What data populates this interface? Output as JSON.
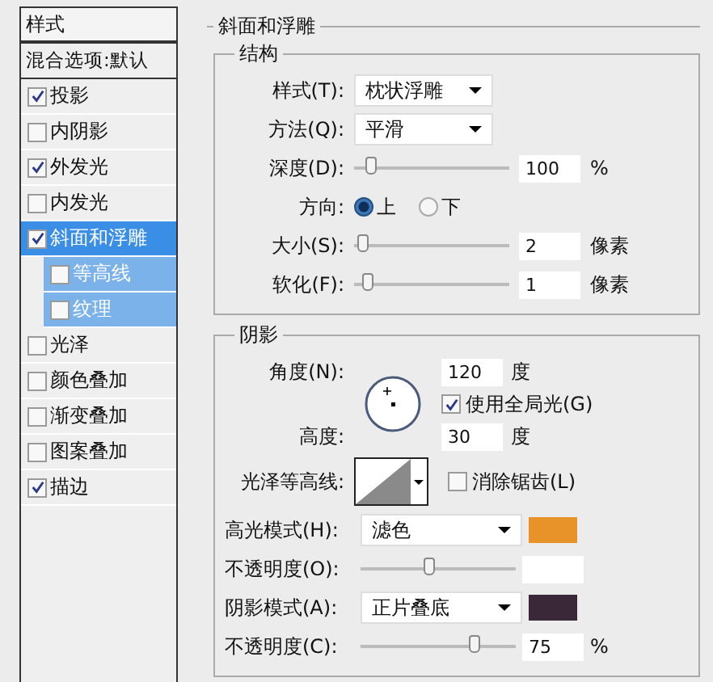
{
  "sidebar": {
    "header": "样式",
    "items": [
      {
        "label": "混合选项:默认",
        "kind": "plain",
        "selected": false
      },
      {
        "label": "投影",
        "kind": "check",
        "checked": true,
        "selected": false
      },
      {
        "label": "内阴影",
        "kind": "check",
        "checked": false,
        "selected": false
      },
      {
        "label": "外发光",
        "kind": "check",
        "checked": true,
        "selected": false
      },
      {
        "label": "内发光",
        "kind": "check",
        "checked": false,
        "selected": false
      },
      {
        "label": "斜面和浮雕",
        "kind": "check",
        "checked": true,
        "selected": true,
        "children": [
          {
            "label": "等高线",
            "checked": false,
            "selected": false
          },
          {
            "label": "纹理",
            "checked": false,
            "selected": false
          }
        ]
      },
      {
        "label": "光泽",
        "kind": "check",
        "checked": false,
        "selected": false
      },
      {
        "label": "颜色叠加",
        "kind": "check",
        "checked": false,
        "selected": false
      },
      {
        "label": "渐变叠加",
        "kind": "check",
        "checked": false,
        "selected": false
      },
      {
        "label": "图案叠加",
        "kind": "check",
        "checked": false,
        "selected": false
      },
      {
        "label": "描边",
        "kind": "check",
        "checked": true,
        "selected": false
      }
    ]
  },
  "panel": {
    "title": "斜面和浮雕",
    "structure": {
      "title": "结构",
      "rows": [
        {
          "kind": "dropdown",
          "label": "样式(T):",
          "value": "枕状浮雕"
        },
        {
          "kind": "dropdown",
          "label": "方法(Q):",
          "value": "平滑"
        },
        {
          "kind": "slider",
          "label": "深度(D):",
          "level": 0.08,
          "value": "100",
          "unit": "%"
        },
        {
          "kind": "radio",
          "label": "方向:",
          "options": [
            {
              "label": "上",
              "selected": true
            },
            {
              "label": "下",
              "selected": false
            }
          ]
        },
        {
          "kind": "slider",
          "label": "大小(S):",
          "level": 0.02,
          "value": "2",
          "unit": "像素"
        },
        {
          "kind": "slider",
          "label": "软化(F):",
          "level": 0.06,
          "value": "1",
          "unit": "像素"
        }
      ]
    },
    "shading": {
      "title": "阴影",
      "angle": {
        "label": "角度(N):",
        "value": "120",
        "unit": "度"
      },
      "global_light": {
        "label": "使用全局光(G)",
        "checked": true
      },
      "altitude": {
        "label": "高度:",
        "value": "30",
        "unit": "度"
      },
      "gloss_contour": {
        "label": "光泽等高线:"
      },
      "anti_alias": {
        "label": "消除锯齿(L)",
        "checked": false
      },
      "rows": [
        {
          "kind": "mode",
          "label": "高光模式(H):",
          "value": "滤色",
          "color": "#e8932a"
        },
        {
          "kind": "slider",
          "label": "不透明度(O):",
          "level": 0.44
        },
        {
          "kind": "mode",
          "label": "阴影模式(A):",
          "value": "正片叠底",
          "color": "#3a2838"
        },
        {
          "kind": "slider",
          "label": "不透明度(C):",
          "level": 0.75,
          "value": "75",
          "unit": "%"
        }
      ]
    }
  }
}
